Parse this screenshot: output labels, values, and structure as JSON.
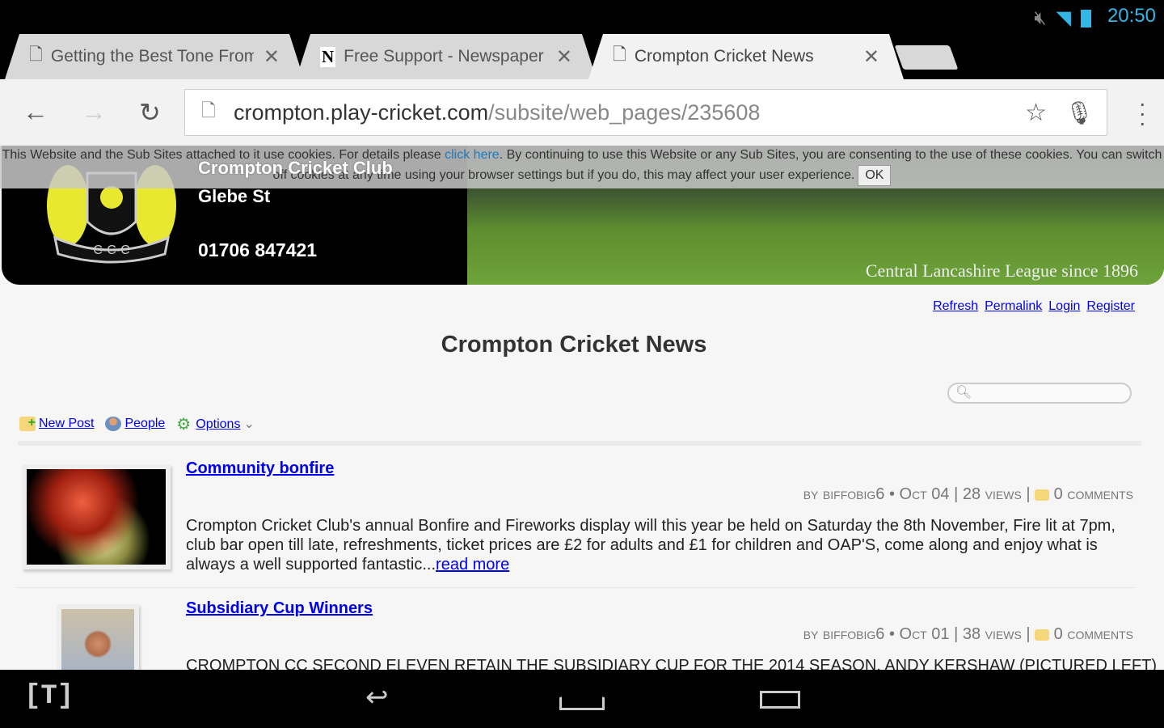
{
  "status": {
    "time": "20:50",
    "icons": [
      "mute-icon",
      "wifi-icon",
      "battery-icon"
    ]
  },
  "tabs": [
    {
      "title": "Getting the Best Tone From Y",
      "icon": "page-icon"
    },
    {
      "title": "Free Support - Newspaper - ",
      "icon": "newspaper-n-icon",
      "favicon": "N"
    },
    {
      "title": "Crompton Cricket News",
      "icon": "page-icon",
      "active": true
    }
  ],
  "omnibox": {
    "host": "crompton.play-cricket.com",
    "path": "/subsite/web_pages/235608"
  },
  "cookie": {
    "text1": "This Website and the Sub Sites attached to it use cookies. For details please ",
    "link": "click here",
    "text2": ". By continuing to use this Website or any Sub Sites, you are consenting to the use of these cookies. You can switch",
    "text3": "off cookies at any time using your browser settings but if you do, this may affect your user experience.",
    "ok": "OK"
  },
  "banner": {
    "name": "Crompton Cricket Club",
    "street": "Glebe St",
    "phone": "01706 847421",
    "tagline": "Central Lancashire League since 1896",
    "crest_text": "C·C·C"
  },
  "links": [
    "Refresh",
    "Permalink",
    "Login",
    "Register"
  ],
  "page_title": "Crompton Cricket News",
  "tools": {
    "new_post": "New Post",
    "people": "People",
    "options": "Options"
  },
  "posts": [
    {
      "title": "Community bonfire",
      "by": "by biffobig6",
      "date": "Oct 04",
      "views": "28 views",
      "comments": "0 comments",
      "body": "Crompton Cricket Club's annual Bonfire and Fireworks display will this year be held on Saturday the 8th November, Fire lit at 7pm, club bar open till late, refreshments, ticket prices are £2 for adults and £1 for children and OAP'S, come along and enjoy what is always a well supported fantastic...",
      "more": "read more"
    },
    {
      "title": "Subsidiary Cup Winners",
      "by": "by biffobig6",
      "date": "Oct 01",
      "views": "38 views",
      "comments": "0 comments",
      "body": "CROMPTON CC SECOND ELEVEN RETAIN THE SUBSIDIARY CUP FOR THE 2014 SEASON. ANDY KERSHAW (PICTURED LEFT)"
    }
  ],
  "navbar": {
    "logo": "[T]"
  }
}
